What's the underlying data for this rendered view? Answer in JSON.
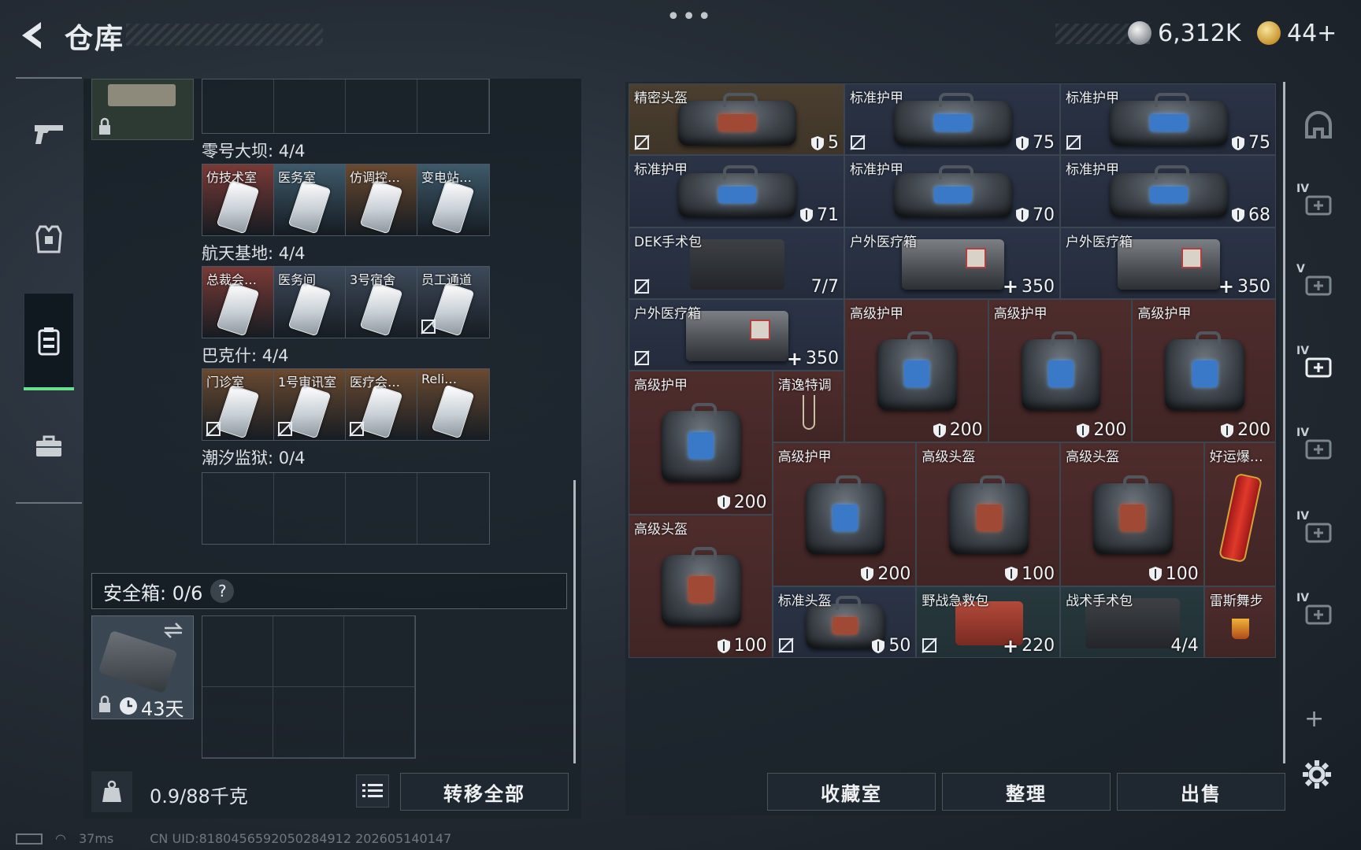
{
  "header": {
    "title": "仓库",
    "more": "•••",
    "currency_silver": "6,312K",
    "currency_gold": "44+",
    "tiny_note": "..."
  },
  "left_sidebar": {
    "items": [
      {
        "name": "weapons",
        "icon": "pistol-icon"
      },
      {
        "name": "equipment",
        "icon": "armor-vest-icon"
      },
      {
        "name": "stash",
        "icon": "keycard-box-icon",
        "active": true
      },
      {
        "name": "toolbox",
        "icon": "briefcase-icon"
      }
    ]
  },
  "keycard_sections": [
    {
      "title": "零号大坝: 4/4",
      "slots": [
        {
          "label": "仿技术室",
          "color": "#7a3a36",
          "noloot": false
        },
        {
          "label": "医务室",
          "color": "#3e5a6a",
          "noloot": false
        },
        {
          "label": "仿调控…",
          "color": "#6a4a30",
          "noloot": false
        },
        {
          "label": "变电站…",
          "color": "#3e5a6a",
          "noloot": false
        }
      ]
    },
    {
      "title": "航天基地: 4/4",
      "slots": [
        {
          "label": "总裁会…",
          "color": "#7a3a36",
          "noloot": false
        },
        {
          "label": "医务间",
          "color": "#3e4a5a",
          "noloot": false
        },
        {
          "label": "3号宿舍",
          "color": "#3e4a5a",
          "noloot": false
        },
        {
          "label": "员工通道",
          "color": "#3e4a5a",
          "noloot": true
        }
      ]
    },
    {
      "title": "巴克什: 4/4",
      "slots": [
        {
          "label": "门诊室",
          "color": "#6a4a30",
          "noloot": true
        },
        {
          "label": "1号审讯室",
          "color": "#6a4a30",
          "noloot": true
        },
        {
          "label": "医疗会…",
          "color": "#6a4a30",
          "noloot": true
        },
        {
          "label": "Reli…",
          "color": "#6a4a30",
          "noloot": false
        }
      ]
    }
  ],
  "empty_section": {
    "title": "潮汐监狱: 0/4"
  },
  "safe_box": {
    "title": "安全箱: 0/6",
    "help": "?",
    "duration": "43天"
  },
  "bottom_left": {
    "weight": "0.9/88千克",
    "transfer_all": "转移全部"
  },
  "inventory": [
    {
      "name": "精密头盔",
      "value": "5",
      "val_icon": "shield",
      "noloot": true,
      "kind": "bag-red",
      "color": "brown"
    },
    {
      "name": "标准护甲",
      "value": "75",
      "val_icon": "shield",
      "noloot": true,
      "kind": "bag-blue",
      "color": "blue"
    },
    {
      "name": "标准护甲",
      "value": "75",
      "val_icon": "shield",
      "noloot": true,
      "kind": "bag-blue",
      "color": "blue"
    },
    {
      "name": "标准护甲",
      "value": "71",
      "val_icon": "shield",
      "noloot": false,
      "kind": "bag-blue",
      "color": "blue"
    },
    {
      "name": "标准护甲",
      "value": "70",
      "val_icon": "shield",
      "noloot": false,
      "kind": "bag-blue",
      "color": "blue"
    },
    {
      "name": "标准护甲",
      "value": "68",
      "val_icon": "shield",
      "noloot": false,
      "kind": "bag-blue",
      "color": "blue"
    },
    {
      "name": "DEK手术包",
      "value": "7/7",
      "val_icon": "",
      "noloot": true,
      "kind": "pouch",
      "color": "blue"
    },
    {
      "name": "户外医疗箱",
      "value": "350",
      "val_icon": "plus",
      "noloot": false,
      "kind": "case",
      "color": "blue"
    },
    {
      "name": "户外医疗箱",
      "value": "350",
      "val_icon": "plus",
      "noloot": false,
      "kind": "case",
      "color": "blue"
    },
    {
      "name": "户外医疗箱",
      "value": "350",
      "val_icon": "plus",
      "noloot": true,
      "kind": "case",
      "color": "blue"
    },
    {
      "name": "高级护甲",
      "value": "200",
      "val_icon": "shield",
      "noloot": false,
      "kind": "bag-blue",
      "color": "red"
    },
    {
      "name": "高级护甲",
      "value": "200",
      "val_icon": "shield",
      "noloot": false,
      "kind": "bag-blue",
      "color": "red"
    },
    {
      "name": "高级护甲",
      "value": "200",
      "val_icon": "shield",
      "noloot": false,
      "kind": "bag-blue",
      "color": "red"
    },
    {
      "name": "高级护甲",
      "value": "200",
      "val_icon": "shield",
      "noloot": false,
      "kind": "bag-blue",
      "color": "red"
    },
    {
      "name": "清逸特调",
      "value": "",
      "val_icon": "",
      "noloot": false,
      "kind": "glass",
      "color": "red"
    },
    {
      "name": "高级护甲",
      "value": "200",
      "val_icon": "shield",
      "noloot": false,
      "kind": "bag-blue",
      "color": "red"
    },
    {
      "name": "高级头盔",
      "value": "100",
      "val_icon": "shield",
      "noloot": false,
      "kind": "bag-red",
      "color": "red"
    },
    {
      "name": "高级头盔",
      "value": "100",
      "val_icon": "shield",
      "noloot": false,
      "kind": "bag-red",
      "color": "red"
    },
    {
      "name": "好运爆…",
      "value": "",
      "val_icon": "",
      "noloot": false,
      "kind": "firecracker",
      "color": "red"
    },
    {
      "name": "高级头盔",
      "value": "100",
      "val_icon": "shield",
      "noloot": false,
      "kind": "bag-red",
      "color": "red"
    },
    {
      "name": "标准头盔",
      "value": "50",
      "val_icon": "shield",
      "noloot": true,
      "kind": "bag-red",
      "color": "blue"
    },
    {
      "name": "野战急救包",
      "value": "220",
      "val_icon": "plus",
      "noloot": true,
      "kind": "redkit",
      "color": "teal"
    },
    {
      "name": "战术手术包",
      "value": "4/4",
      "val_icon": "",
      "noloot": false,
      "kind": "pouch",
      "color": "teal"
    },
    {
      "name": "雷斯舞步",
      "value": "",
      "val_icon": "",
      "noloot": false,
      "kind": "cocktail",
      "color": "red"
    }
  ],
  "bottom_right": {
    "collection": "收藏室",
    "sort": "整理",
    "sell": "出售"
  },
  "right_sidebar": {
    "items": [
      {
        "name": "helmet-slot",
        "lv": ""
      },
      {
        "name": "armor-slot-iv",
        "lv": "IV"
      },
      {
        "name": "rig-slot-v",
        "lv": "V"
      },
      {
        "name": "medkit-slot-iv",
        "lv": "IV"
      },
      {
        "name": "cleaning-slot-iv",
        "lv": "IV"
      },
      {
        "name": "medkit2-slot-iv",
        "lv": "IV"
      },
      {
        "name": "cleaning2-slot-iv",
        "lv": "IV"
      }
    ],
    "add": "+"
  },
  "status_bar": {
    "ping": "37ms",
    "uid": "CN UID:8180456592050284912 202605140147"
  },
  "colors": {
    "active_green": "#69e08e",
    "cell_brown": "#4b3f30",
    "cell_blue": "#2b3446",
    "cell_red": "#4e2c2c",
    "cell_teal": "#27393e"
  }
}
